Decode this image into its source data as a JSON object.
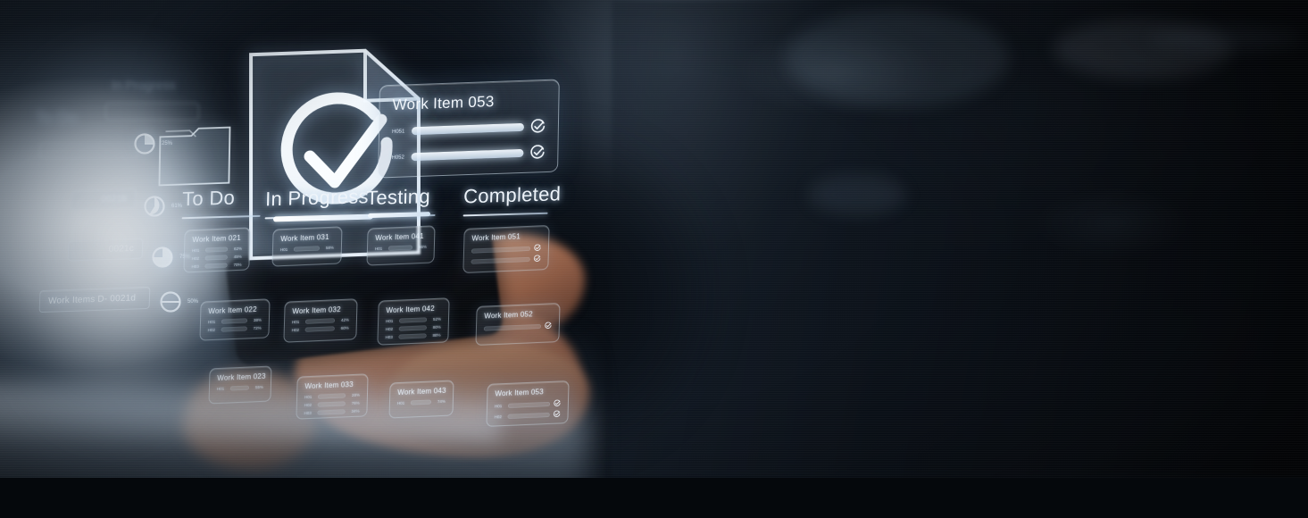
{
  "scene": {
    "type": "holographic-kanban-board",
    "subject": "businessman holding smartphone projecting holographic project board",
    "palette": {
      "background_dark": "#0a1018",
      "background_mid": "#16202c",
      "hologram_white": "#eef4fa",
      "hologram_glow": "#a8cdf0",
      "glass_fill": "rgba(176,194,214,0.17)",
      "highlight_haze": "#f4f9fe"
    }
  },
  "board": {
    "columns": [
      {
        "id": "todo",
        "label": "To Do",
        "cards": [
          {
            "title": "Work Item 021",
            "bars": [
              {
                "label": "H01",
                "percent": 62,
                "pct_label": "62%",
                "done": false
              },
              {
                "label": "H02",
                "percent": 45,
                "pct_label": "45%",
                "done": false
              },
              {
                "label": "H03",
                "percent": 70,
                "pct_label": "70%",
                "done": false
              }
            ]
          },
          {
            "title": "Work Item 022",
            "bars": [
              {
                "label": "H01",
                "percent": 38,
                "pct_label": "38%",
                "done": false
              },
              {
                "label": "H02",
                "percent": 72,
                "pct_label": "72%",
                "done": false
              }
            ]
          },
          {
            "title": "Work Item 023",
            "bars": [
              {
                "label": "H01",
                "percent": 55,
                "pct_label": "55%",
                "done": false
              }
            ]
          }
        ]
      },
      {
        "id": "in-progress",
        "label": "In Progress",
        "cards": [
          {
            "title": "Work Item 031",
            "bars": [
              {
                "label": "H01",
                "percent": 58,
                "pct_label": "58%",
                "done": false
              }
            ]
          },
          {
            "title": "Work Item 032",
            "bars": [
              {
                "label": "H01",
                "percent": 42,
                "pct_label": "42%",
                "done": false
              },
              {
                "label": "H02",
                "percent": 60,
                "pct_label": "60%",
                "done": false
              }
            ]
          },
          {
            "title": "Work Item 033",
            "bars": [
              {
                "label": "H01",
                "percent": 28,
                "pct_label": "28%",
                "done": false
              },
              {
                "label": "H02",
                "percent": 76,
                "pct_label": "76%",
                "done": false
              },
              {
                "label": "H03",
                "percent": 34,
                "pct_label": "34%",
                "done": false
              }
            ]
          }
        ]
      },
      {
        "id": "testing",
        "label": "Testing",
        "cards": [
          {
            "title": "Work Item 041",
            "bars": [
              {
                "label": "H01",
                "percent": 66,
                "pct_label": "66%",
                "done": false
              }
            ]
          },
          {
            "title": "Work Item 042",
            "bars": [
              {
                "label": "H01",
                "percent": 52,
                "pct_label": "52%",
                "done": false
              },
              {
                "label": "H02",
                "percent": 80,
                "pct_label": "80%",
                "done": false
              },
              {
                "label": "H03",
                "percent": 88,
                "pct_label": "88%",
                "done": false
              }
            ]
          },
          {
            "title": "Work Item 043",
            "bars": [
              {
                "label": "H01",
                "percent": 74,
                "pct_label": "74%",
                "done": false
              }
            ]
          }
        ]
      },
      {
        "id": "completed",
        "label": "Completed",
        "cards": [
          {
            "title": "Work Item 051",
            "bars": [
              {
                "label": "H01",
                "percent": 100,
                "pct_label": "100%",
                "done": true
              },
              {
                "label": "H02",
                "percent": 100,
                "pct_label": "100%",
                "done": true
              }
            ]
          },
          {
            "title": "Work Item 052",
            "bars": [
              {
                "label": "H01",
                "percent": 100,
                "pct_label": "100%",
                "done": true
              }
            ]
          },
          {
            "title": "Work Item 053",
            "bars": [
              {
                "label": "H01",
                "percent": 100,
                "pct_label": "100%",
                "done": true
              },
              {
                "label": "H02",
                "percent": 100,
                "pct_label": "100%",
                "done": true
              }
            ]
          }
        ]
      }
    ]
  },
  "detail_card": {
    "title": "Work Item 053",
    "rows": [
      {
        "label": "H051",
        "percent": 100,
        "done": true
      },
      {
        "label": "H052",
        "percent": 100,
        "done": true
      }
    ]
  },
  "icons": {
    "document_check": "document-check-icon",
    "folder": "folder-icon",
    "check_circle": "check-circle-icon",
    "pie_chart": "pie-chart-icon"
  },
  "progress_indicators": [
    {
      "id": "p1",
      "value": 25,
      "label": "25%"
    },
    {
      "id": "p2",
      "value": 61,
      "label": "61%"
    },
    {
      "id": "p3",
      "value": 75,
      "label": "75%"
    },
    {
      "id": "p4",
      "value": 50,
      "label": "50%"
    }
  ],
  "tags": [
    {
      "id": "tag-b",
      "label": "0021b"
    },
    {
      "id": "tag-c",
      "label": "0021c"
    },
    {
      "id": "tag-d",
      "label": "Work Items D- 0021d"
    }
  ],
  "ghost_labels": [
    {
      "id": "ghost-in-progress",
      "label": "In Progress"
    },
    {
      "id": "ghost-to-do",
      "label": "To Do"
    }
  ]
}
